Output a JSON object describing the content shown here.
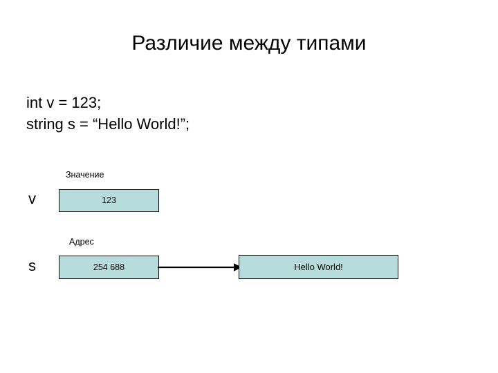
{
  "slide": {
    "title": "Различие между типами",
    "background_color": "#ffffff",
    "text_color": "#000000"
  },
  "code": {
    "lines": [
      "int v = 123;",
      "string s = “Hello World!”;"
    ]
  },
  "diagram": {
    "box_fill_color": "#b6dcdc",
    "box_border_color": "#000000",
    "arrow_color": "#000000",
    "value_row": {
      "column_label": "Значение",
      "variable_label": "v",
      "cell_value": "123"
    },
    "address_row": {
      "column_label": "Адрес",
      "variable_label": "s",
      "cell_value": "254 688",
      "target_value": "Hello World!"
    }
  }
}
